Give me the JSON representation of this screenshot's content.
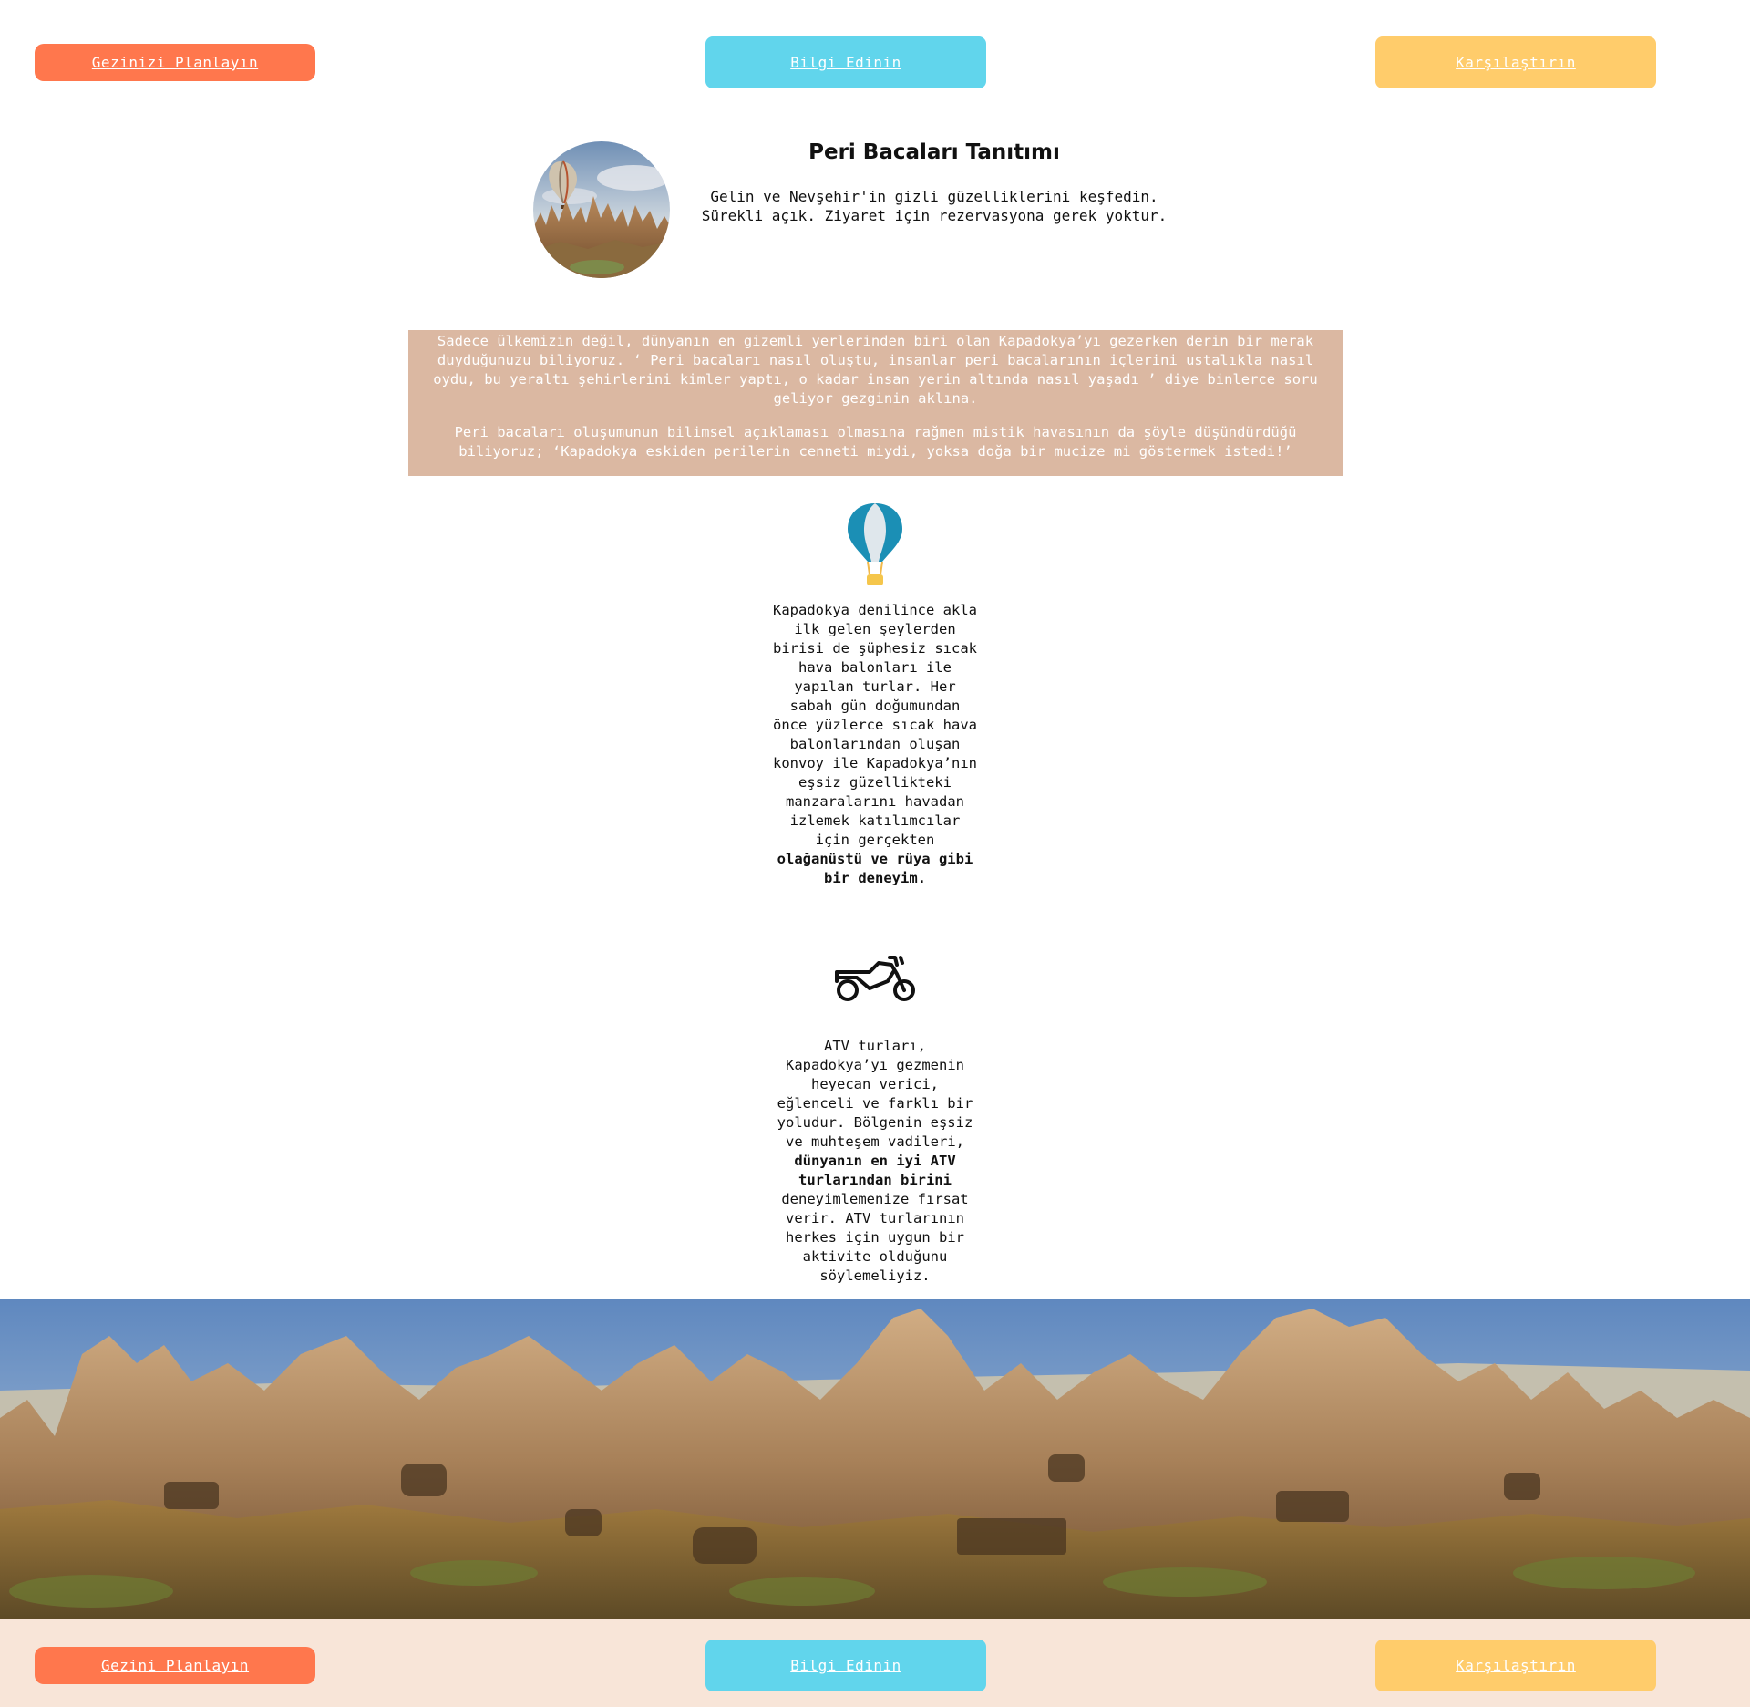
{
  "header": {
    "buttons": [
      {
        "label": "Gezinizi Planlayın",
        "color": "#ff774d"
      },
      {
        "label": "Bilgi Edinin",
        "color": "#61d5ec"
      },
      {
        "label": "Karşılaştırın",
        "color": "#ffcc6b"
      }
    ]
  },
  "hero": {
    "title": "Peri Bacaları Tanıtımı",
    "subtitle_line1": "Gelin ve Nevşehir'in gizli güzelliklerini keşfedin.",
    "subtitle_line2": "Sürekli açık. Ziyaret için rezervasyona gerek yoktur.",
    "image_icon": "cappadocia-balloon-photo"
  },
  "intro": {
    "paragraph1": "Sadece ülkemizin değil, dünyanın en gizemli yerlerinden biri olan Kapadokya’yı gezerken derin bir merak duyduğunuzu biliyoruz. ‘ Peri bacaları nasıl oluştu, insanlar peri bacalarının içlerini ustalıkla nasıl oydu, bu yeraltı şehirlerini kimler yaptı, o kadar insan yerin altında nasıl yaşadı ’ diye binlerce soru geliyor gezginin aklına.",
    "paragraph2": "Peri bacaları oluşumunun bilimsel açıklaması olmasına rağmen mistik havasının da şöyle düşündürdüğü biliyoruz; ‘Kapadokya eskiden perilerin cenneti miydi, yoksa doğa bir mucize mi göstermek istedi!’",
    "background": "#dbb8a2"
  },
  "features": {
    "balloon": {
      "icon": "hot-air-balloon-icon",
      "text": "Kapadokya denilince akla ilk gelen şeylerden birisi de şüphesiz sıcak hava balonları ile yapılan turlar. Her sabah gün doğumundan önce yüzlerce sıcak hava balonlarından oluşan konvoy ile Kapadokya’nın eşsiz güzellikteki manzaralarını havadan izlemek katılımcılar için gerçekten",
      "bold": "olağanüstü ve rüya gibi bir deneyim."
    },
    "atv": {
      "icon": "motorcycle-icon",
      "text_before": "ATV turları, Kapadokya’yı gezmenin heyecan verici, eğlenceli ve farklı bir yoludur. Bölgenin eşsiz ve muhteşem vadileri,",
      "bold": "dünyanın en iyi ATV turlarından birini",
      "text_after": "deneyimlemenize fırsat verir. ATV turlarının herkes için uygun bir aktivite olduğunu söylemeliyiz."
    }
  },
  "banner": {
    "image": "fairy-chimneys-panorama"
  },
  "footer": {
    "background": "#f8e5d8",
    "buttons": [
      {
        "label": "Gezini Planlayın"
      },
      {
        "label": "Bilgi Edinin"
      },
      {
        "label": "Karşılaştırın"
      }
    ]
  }
}
